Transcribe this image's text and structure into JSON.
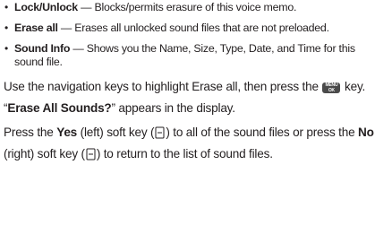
{
  "bullets": [
    {
      "term": "Lock/Unlock",
      "desc": " — Blocks/permits erasure of this voice memo."
    },
    {
      "term": "Erase all",
      "desc": " — Erases all unlocked sound files that are not preloaded."
    },
    {
      "term": "Sound Info",
      "desc": " — Shows you the Name, Size, Type, Date, and Time for this sound file."
    }
  ],
  "para1": {
    "before": "Use the navigation keys to highlight Erase all, then press the ",
    "key_top": "MENU",
    "key_bottom": "OK",
    "after": " key. “",
    "bold": "Erase All Sounds?",
    "end": "” appears in the display."
  },
  "para2": {
    "t1": "Press the ",
    "yes": "Yes",
    "t2": " (left) soft key (",
    "t3": ") to all of the sound files or press the ",
    "no": "No",
    "t4": " (right) soft key (",
    "t5": ") to return to the list of sound files."
  },
  "icons": [
    "menu-ok-key-icon",
    "left-softkey-icon",
    "right-softkey-icon"
  ]
}
